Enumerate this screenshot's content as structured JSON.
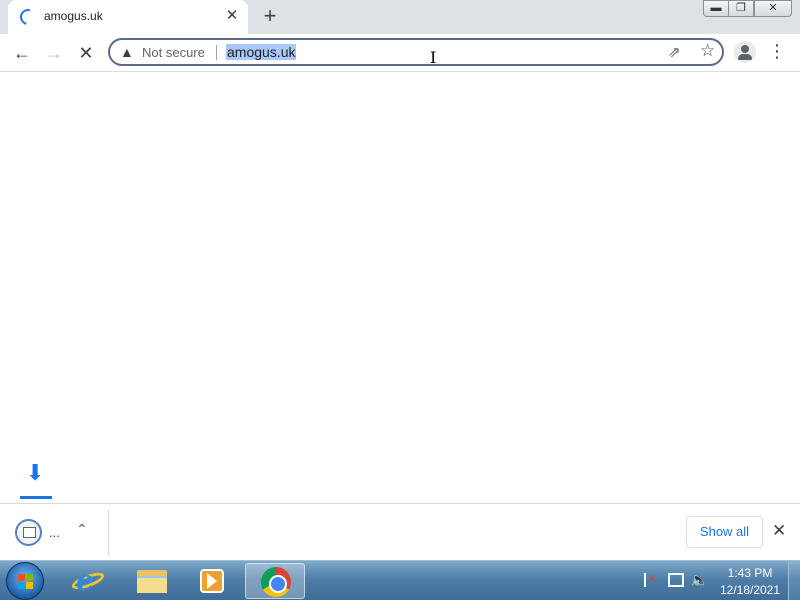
{
  "browser": {
    "tab": {
      "title": "amogus.uk",
      "close_label": "✕",
      "loading_icon": "loading-spinner-icon"
    },
    "new_tab_label": "+",
    "window_controls": {
      "minimize": "▬",
      "maximize": "❐",
      "close": "✕"
    },
    "toolbar": {
      "back": "←",
      "forward": "→",
      "stop": "✕",
      "security_icon": "▲",
      "security_label": "Not secure",
      "url": "amogus.uk",
      "share": "⇗",
      "bookmark": "☆",
      "menu": "⋮",
      "cursor": "I"
    },
    "downloads": {
      "indicator_arrow": "⬇",
      "item_name": "...",
      "item_chevron": "⌃",
      "show_all_label": "Show all",
      "close_label": "✕"
    },
    "colors": {
      "accent": "#1a73e8",
      "selection": "#a8c7fa",
      "tabstrip": "#dee1e6"
    }
  },
  "taskbar": {
    "pinned": [
      "Internet Explorer",
      "Windows Explorer",
      "Windows Media Player",
      "Google Chrome"
    ],
    "active": "Google Chrome",
    "tray": {
      "volume": "🔈",
      "time": "1:43 PM",
      "date": "12/18/2021"
    }
  }
}
